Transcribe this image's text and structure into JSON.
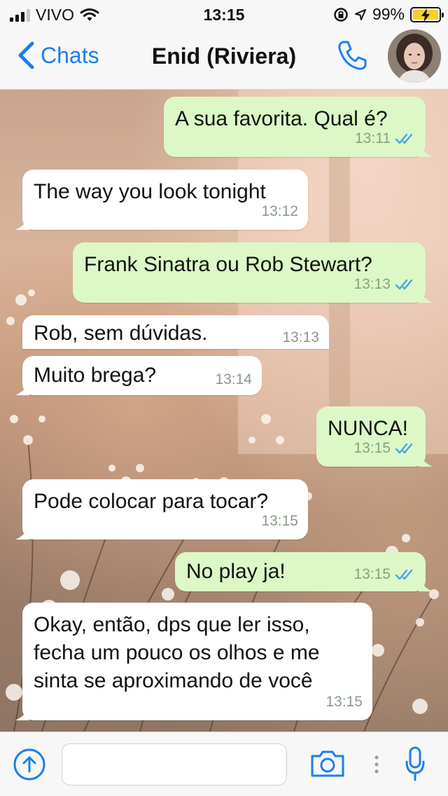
{
  "status_bar": {
    "carrier": "VIVO",
    "time": "13:15",
    "battery": "99%",
    "icons": [
      "signal-icon",
      "wifi-icon",
      "orientation-lock-icon",
      "location-icon",
      "battery-charging-icon"
    ]
  },
  "nav": {
    "back_label": "Chats",
    "title": "Enid (Riviera)",
    "icons": [
      "chevron-left-icon",
      "phone-icon",
      "avatar"
    ]
  },
  "messages": [
    {
      "dir": "out",
      "text": "A sua favorita. Qual é?",
      "time": "13:11",
      "read": true
    },
    {
      "dir": "in",
      "text": "The way you look tonight",
      "time": "13:12"
    },
    {
      "dir": "out",
      "text": "Frank Sinatra ou Rob Stewart?",
      "time": "13:13",
      "read": true
    },
    {
      "dir": "in",
      "text": "Rob, sem dúvidas.",
      "time": "13:13"
    },
    {
      "dir": "in",
      "text": "Muito brega?",
      "time": "13:14"
    },
    {
      "dir": "out",
      "text": "NUNCA!",
      "time": "13:15",
      "read": true
    },
    {
      "dir": "in",
      "text": "Pode colocar para tocar?",
      "time": "13:15"
    },
    {
      "dir": "out",
      "text": "No play ja!",
      "time": "13:15",
      "read": true
    },
    {
      "dir": "in",
      "text": "Okay, então, dps que ler isso, fecha um pouco os olhos e me sinta se aproximando de você",
      "time": "13:15"
    }
  ],
  "input_bar": {
    "text_value": "",
    "icons": [
      "plus-icon",
      "camera-icon",
      "more-icon",
      "microphone-icon"
    ]
  },
  "colors": {
    "accent": "#1a7ff0",
    "outgoing_bubble": "#dcf8c6",
    "incoming_bubble": "#ffffff",
    "read_ticks": "#4aa3ea"
  }
}
